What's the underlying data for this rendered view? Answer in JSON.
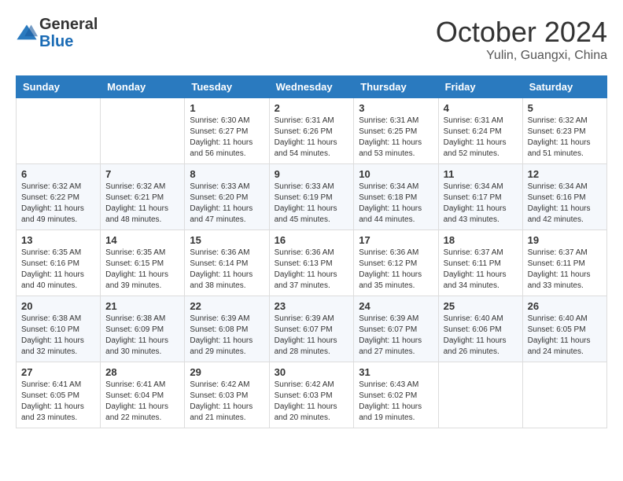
{
  "header": {
    "logo_general": "General",
    "logo_blue": "Blue",
    "month_year": "October 2024",
    "location": "Yulin, Guangxi, China"
  },
  "days_of_week": [
    "Sunday",
    "Monday",
    "Tuesday",
    "Wednesday",
    "Thursday",
    "Friday",
    "Saturday"
  ],
  "weeks": [
    [
      {
        "day": "",
        "sunrise": "",
        "sunset": "",
        "daylight": ""
      },
      {
        "day": "",
        "sunrise": "",
        "sunset": "",
        "daylight": ""
      },
      {
        "day": "1",
        "sunrise": "Sunrise: 6:30 AM",
        "sunset": "Sunset: 6:27 PM",
        "daylight": "Daylight: 11 hours and 56 minutes."
      },
      {
        "day": "2",
        "sunrise": "Sunrise: 6:31 AM",
        "sunset": "Sunset: 6:26 PM",
        "daylight": "Daylight: 11 hours and 54 minutes."
      },
      {
        "day": "3",
        "sunrise": "Sunrise: 6:31 AM",
        "sunset": "Sunset: 6:25 PM",
        "daylight": "Daylight: 11 hours and 53 minutes."
      },
      {
        "day": "4",
        "sunrise": "Sunrise: 6:31 AM",
        "sunset": "Sunset: 6:24 PM",
        "daylight": "Daylight: 11 hours and 52 minutes."
      },
      {
        "day": "5",
        "sunrise": "Sunrise: 6:32 AM",
        "sunset": "Sunset: 6:23 PM",
        "daylight": "Daylight: 11 hours and 51 minutes."
      }
    ],
    [
      {
        "day": "6",
        "sunrise": "Sunrise: 6:32 AM",
        "sunset": "Sunset: 6:22 PM",
        "daylight": "Daylight: 11 hours and 49 minutes."
      },
      {
        "day": "7",
        "sunrise": "Sunrise: 6:32 AM",
        "sunset": "Sunset: 6:21 PM",
        "daylight": "Daylight: 11 hours and 48 minutes."
      },
      {
        "day": "8",
        "sunrise": "Sunrise: 6:33 AM",
        "sunset": "Sunset: 6:20 PM",
        "daylight": "Daylight: 11 hours and 47 minutes."
      },
      {
        "day": "9",
        "sunrise": "Sunrise: 6:33 AM",
        "sunset": "Sunset: 6:19 PM",
        "daylight": "Daylight: 11 hours and 45 minutes."
      },
      {
        "day": "10",
        "sunrise": "Sunrise: 6:34 AM",
        "sunset": "Sunset: 6:18 PM",
        "daylight": "Daylight: 11 hours and 44 minutes."
      },
      {
        "day": "11",
        "sunrise": "Sunrise: 6:34 AM",
        "sunset": "Sunset: 6:17 PM",
        "daylight": "Daylight: 11 hours and 43 minutes."
      },
      {
        "day": "12",
        "sunrise": "Sunrise: 6:34 AM",
        "sunset": "Sunset: 6:16 PM",
        "daylight": "Daylight: 11 hours and 42 minutes."
      }
    ],
    [
      {
        "day": "13",
        "sunrise": "Sunrise: 6:35 AM",
        "sunset": "Sunset: 6:16 PM",
        "daylight": "Daylight: 11 hours and 40 minutes."
      },
      {
        "day": "14",
        "sunrise": "Sunrise: 6:35 AM",
        "sunset": "Sunset: 6:15 PM",
        "daylight": "Daylight: 11 hours and 39 minutes."
      },
      {
        "day": "15",
        "sunrise": "Sunrise: 6:36 AM",
        "sunset": "Sunset: 6:14 PM",
        "daylight": "Daylight: 11 hours and 38 minutes."
      },
      {
        "day": "16",
        "sunrise": "Sunrise: 6:36 AM",
        "sunset": "Sunset: 6:13 PM",
        "daylight": "Daylight: 11 hours and 37 minutes."
      },
      {
        "day": "17",
        "sunrise": "Sunrise: 6:36 AM",
        "sunset": "Sunset: 6:12 PM",
        "daylight": "Daylight: 11 hours and 35 minutes."
      },
      {
        "day": "18",
        "sunrise": "Sunrise: 6:37 AM",
        "sunset": "Sunset: 6:11 PM",
        "daylight": "Daylight: 11 hours and 34 minutes."
      },
      {
        "day": "19",
        "sunrise": "Sunrise: 6:37 AM",
        "sunset": "Sunset: 6:11 PM",
        "daylight": "Daylight: 11 hours and 33 minutes."
      }
    ],
    [
      {
        "day": "20",
        "sunrise": "Sunrise: 6:38 AM",
        "sunset": "Sunset: 6:10 PM",
        "daylight": "Daylight: 11 hours and 32 minutes."
      },
      {
        "day": "21",
        "sunrise": "Sunrise: 6:38 AM",
        "sunset": "Sunset: 6:09 PM",
        "daylight": "Daylight: 11 hours and 30 minutes."
      },
      {
        "day": "22",
        "sunrise": "Sunrise: 6:39 AM",
        "sunset": "Sunset: 6:08 PM",
        "daylight": "Daylight: 11 hours and 29 minutes."
      },
      {
        "day": "23",
        "sunrise": "Sunrise: 6:39 AM",
        "sunset": "Sunset: 6:07 PM",
        "daylight": "Daylight: 11 hours and 28 minutes."
      },
      {
        "day": "24",
        "sunrise": "Sunrise: 6:39 AM",
        "sunset": "Sunset: 6:07 PM",
        "daylight": "Daylight: 11 hours and 27 minutes."
      },
      {
        "day": "25",
        "sunrise": "Sunrise: 6:40 AM",
        "sunset": "Sunset: 6:06 PM",
        "daylight": "Daylight: 11 hours and 26 minutes."
      },
      {
        "day": "26",
        "sunrise": "Sunrise: 6:40 AM",
        "sunset": "Sunset: 6:05 PM",
        "daylight": "Daylight: 11 hours and 24 minutes."
      }
    ],
    [
      {
        "day": "27",
        "sunrise": "Sunrise: 6:41 AM",
        "sunset": "Sunset: 6:05 PM",
        "daylight": "Daylight: 11 hours and 23 minutes."
      },
      {
        "day": "28",
        "sunrise": "Sunrise: 6:41 AM",
        "sunset": "Sunset: 6:04 PM",
        "daylight": "Daylight: 11 hours and 22 minutes."
      },
      {
        "day": "29",
        "sunrise": "Sunrise: 6:42 AM",
        "sunset": "Sunset: 6:03 PM",
        "daylight": "Daylight: 11 hours and 21 minutes."
      },
      {
        "day": "30",
        "sunrise": "Sunrise: 6:42 AM",
        "sunset": "Sunset: 6:03 PM",
        "daylight": "Daylight: 11 hours and 20 minutes."
      },
      {
        "day": "31",
        "sunrise": "Sunrise: 6:43 AM",
        "sunset": "Sunset: 6:02 PM",
        "daylight": "Daylight: 11 hours and 19 minutes."
      },
      {
        "day": "",
        "sunrise": "",
        "sunset": "",
        "daylight": ""
      },
      {
        "day": "",
        "sunrise": "",
        "sunset": "",
        "daylight": ""
      }
    ]
  ]
}
